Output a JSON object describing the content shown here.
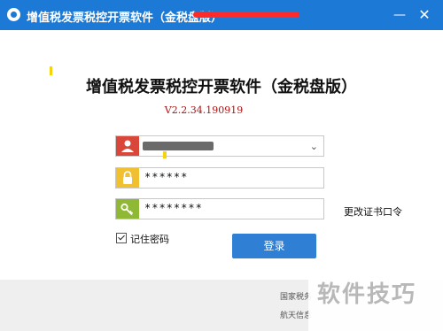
{
  "window": {
    "title": "增值税发票税控开票软件（金税盘版）",
    "minimize_glyph": "—",
    "close_glyph": "✕"
  },
  "main": {
    "heading": "增值税发票税控开票软件（金税盘版）",
    "version": "V2.2.34.190919"
  },
  "login": {
    "username_icon": "user-icon",
    "password_icon": "lock-icon",
    "password_value": "******",
    "cert_icon": "key-icon",
    "cert_password_value": "********",
    "change_cert_link": "更改证书口令",
    "remember_label": "记住密码",
    "login_button": "登录"
  },
  "footer": {
    "line1": "国家税务",
    "line2": "航天信息"
  },
  "watermark": "软件技巧",
  "colors": {
    "titlebar": "#1c7ad6",
    "user_icon_bg": "#d9463a",
    "lock_icon_bg": "#f0c030",
    "key_icon_bg": "#8fb934",
    "login_button_bg": "#2f7fd5",
    "version_text": "#b01010"
  }
}
